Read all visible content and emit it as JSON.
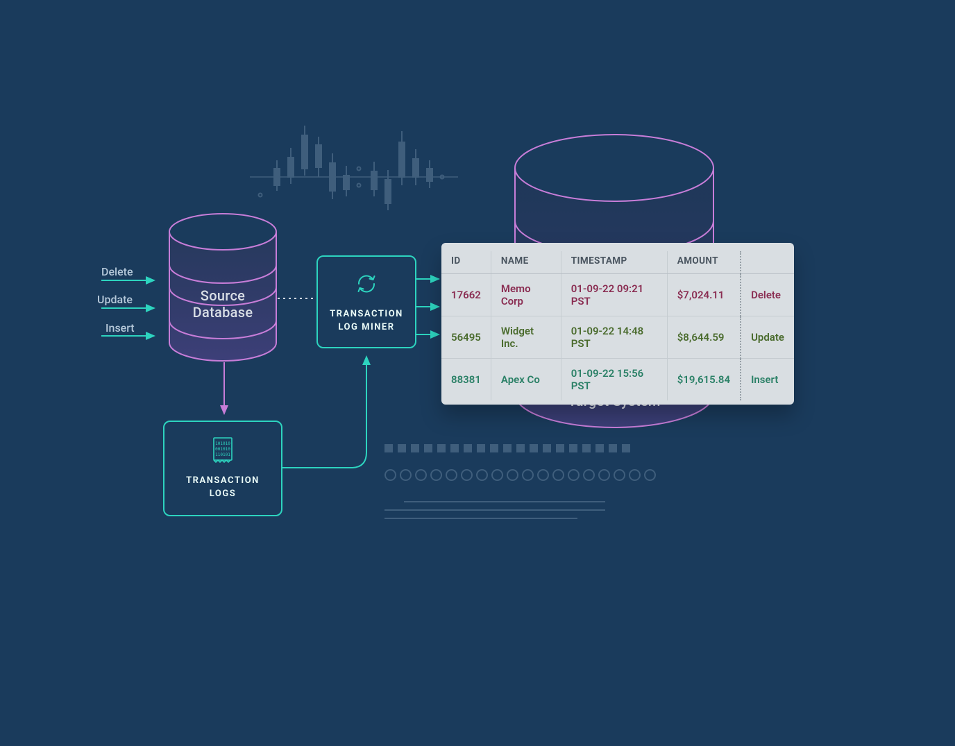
{
  "input_ops": {
    "delete": "Delete",
    "update": "Update",
    "insert": "Insert"
  },
  "source_db": {
    "label_line1": "Source",
    "label_line2": "Database"
  },
  "tx_logs": {
    "title_line1": "TRANSACTION",
    "title_line2": "LOGS"
  },
  "tx_miner": {
    "title_line1": "TRANSACTION",
    "title_line2": "LOG MINER"
  },
  "target": {
    "label": "Target System"
  },
  "table": {
    "headers": {
      "id": "ID",
      "name": "NAME",
      "timestamp": "TIMESTAMP",
      "amount": "AMOUNT"
    },
    "rows": [
      {
        "id": "17662",
        "name": "Memo Corp",
        "timestamp": "01-09-22 09:21 PST",
        "amount": "$7,024.11",
        "action": "Delete",
        "kind": "delete"
      },
      {
        "id": "56495",
        "name": "Widget Inc.",
        "timestamp": "01-09-22 14:48 PST",
        "amount": "$8,644.59",
        "action": "Update",
        "kind": "update"
      },
      {
        "id": "88381",
        "name": "Apex Co",
        "timestamp": "01-09-22 15:56 PST",
        "amount": "$19,615.84",
        "action": "Insert",
        "kind": "insert"
      }
    ]
  },
  "colors": {
    "teal": "#2dd4bf",
    "magenta": "#c77dd8",
    "bg": "#1a3b5c",
    "row_delete": "#8a2d52",
    "row_update": "#4a6b2d",
    "row_insert": "#2a8066"
  }
}
